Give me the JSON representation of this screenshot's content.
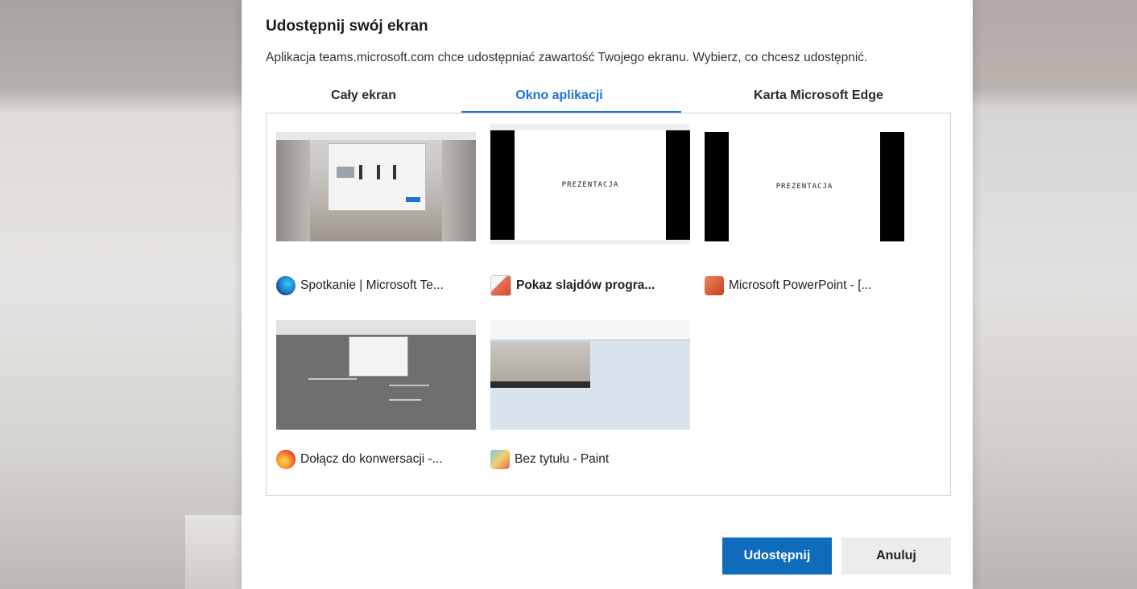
{
  "dialog": {
    "title": "Udostępnij swój ekran",
    "subtitle": "Aplikacja teams.microsoft.com chce udostępniać zawartość Twojego ekranu. Wybierz, co chcesz udostępnić."
  },
  "tabs": [
    {
      "label": "Cały ekran",
      "selected": false
    },
    {
      "label": "Okno aplikacji",
      "selected": true
    },
    {
      "label": "Karta Microsoft Edge",
      "selected": false
    }
  ],
  "windows": [
    {
      "label": "Spotkanie | Microsoft Te...",
      "icon": "edge-icon"
    },
    {
      "label": "Pokaz slajdów progra...",
      "icon": "powerpoint-slideshow-icon"
    },
    {
      "label": "Microsoft PowerPoint - [...",
      "icon": "powerpoint-icon"
    },
    {
      "label": "Dołącz do konwersacji -...",
      "icon": "firefox-icon"
    },
    {
      "label": "Bez tytułu - Paint",
      "icon": "paint-icon"
    }
  ],
  "slide_text": "PREZENTACJA",
  "buttons": {
    "share": "Udostępnij",
    "cancel": "Anuluj"
  },
  "colors": {
    "accent": "#1a73d9",
    "primary_button": "#0f6cbd"
  }
}
